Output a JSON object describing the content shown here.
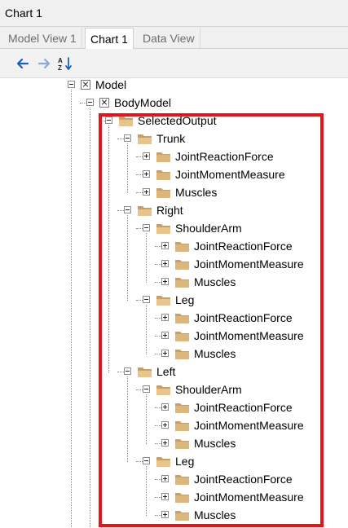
{
  "window": {
    "title": "Chart 1"
  },
  "tabs": [
    {
      "label": "Model View 1"
    },
    {
      "label": "Chart 1"
    },
    {
      "label": "Data View"
    }
  ],
  "toolbar": {
    "back_icon": "arrow-left-icon",
    "forward_icon": "arrow-right-icon",
    "sort_icon": "sort-az-icon"
  },
  "colors": {
    "highlight": "#e3141a",
    "arrows": "#1f5fbf",
    "folder": "#dcb67a"
  },
  "tree": {
    "root": "Model",
    "body_model": "BodyModel",
    "selected_output": "SelectedOutput",
    "trunk": {
      "label": "Trunk",
      "items": [
        "JointReactionForce",
        "JointMomentMeasure",
        "Muscles"
      ]
    },
    "right": {
      "label": "Right",
      "shoulder_arm": {
        "label": "ShoulderArm",
        "items": [
          "JointReactionForce",
          "JointMomentMeasure",
          "Muscles"
        ]
      },
      "leg": {
        "label": "Leg",
        "items": [
          "JointReactionForce",
          "JointMomentMeasure",
          "Muscles"
        ]
      }
    },
    "left": {
      "label": "Left",
      "shoulder_arm": {
        "label": "ShoulderArm",
        "items": [
          "JointReactionForce",
          "JointMomentMeasure",
          "Muscles"
        ]
      },
      "leg": {
        "label": "Leg",
        "items": [
          "JointReactionForce",
          "JointMomentMeasure",
          "Muscles"
        ]
      }
    }
  }
}
